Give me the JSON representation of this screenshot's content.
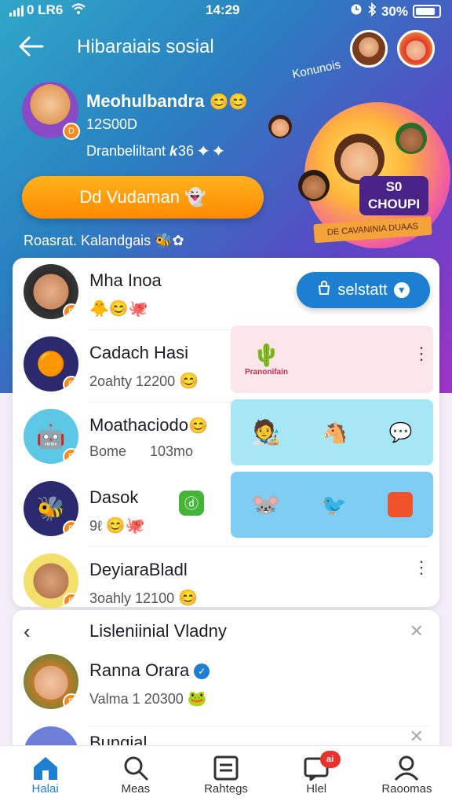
{
  "status_bar": {
    "carrier": "0 LR6",
    "time": "14:29",
    "battery": "30%"
  },
  "header": {
    "title": "Hibaraiais sosial"
  },
  "profile": {
    "name": "Meohulbandra",
    "number": "12S00D",
    "description": "Dranbeliltant 𝒌36 ✦ ✦",
    "cta_label": "Dd Vudaman",
    "hint": "Roasrat. Kalandgais"
  },
  "illustration": {
    "banner_text": "Konunois",
    "group_label_line1": "S0",
    "group_label_line2": "CHOUPI",
    "ribbon_text": "DE CAVANINIA DUAAS"
  },
  "contacts": [
    {
      "name": "Mha Inoa",
      "sub": "",
      "button_label": "selstatt"
    },
    {
      "name": "Cadach Hasi",
      "sub": "2oahty 12200",
      "tile_label": "Pranonifain"
    },
    {
      "name": "Moathaciodo",
      "sub": "Bome      103mo"
    },
    {
      "name": "Dasok",
      "sub": "9ℓ"
    },
    {
      "name": "DeyiaraBladl",
      "sub": "3oahly 12100"
    }
  ],
  "section": {
    "title": "Lisleniinial Vladny"
  },
  "section_rows": [
    {
      "name": "Ranna Orara",
      "sub": "Valma 1 20300"
    },
    {
      "name": "Bungial",
      "sub": ""
    }
  ],
  "tabbar": {
    "tabs": [
      {
        "label": "Halai",
        "icon": "home-icon"
      },
      {
        "label": "Meas",
        "icon": "search-icon"
      },
      {
        "label": "Rahtegs",
        "icon": "list-icon"
      },
      {
        "label": "Hlel",
        "icon": "chat-icon",
        "badge": "ai"
      },
      {
        "label": "Raoomas",
        "icon": "profile-icon"
      }
    ]
  },
  "colors": {
    "accent": "#1c7fd1",
    "cta": "#ff9a0f",
    "badge": "#f58a1f",
    "notification": "#e8322b"
  }
}
